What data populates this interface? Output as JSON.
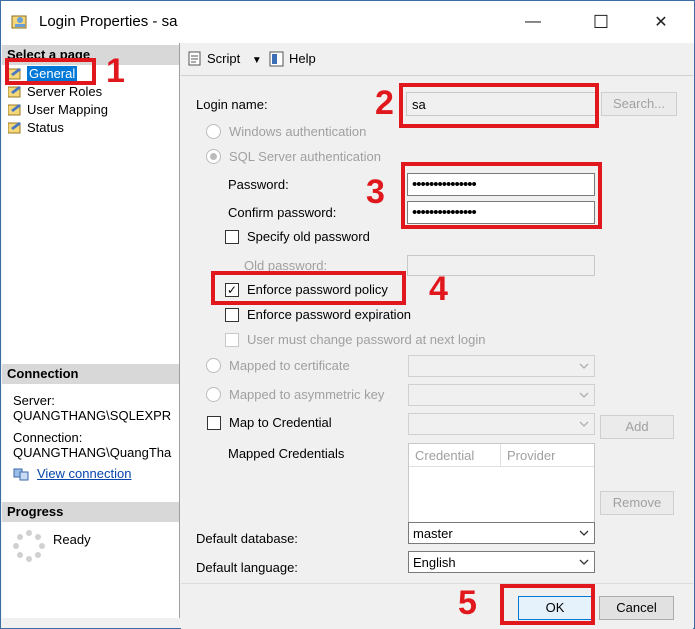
{
  "window": {
    "title": "Login Properties - sa",
    "minimize": "—",
    "maximize": "☐",
    "close": "✕"
  },
  "left": {
    "select_page_header": "Select a page",
    "pages": [
      "General",
      "Server Roles",
      "User Mapping",
      "Status"
    ],
    "connection_header": "Connection",
    "server_label": "Server:",
    "server_value": "QUANGTHANG\\SQLEXPR",
    "connection_label": "Connection:",
    "connection_value": "QUANGTHANG\\QuangTha",
    "view_connection": "View connection",
    "progress_header": "Progress",
    "progress_status": "Ready"
  },
  "toolbar": {
    "script": "Script",
    "help": "Help"
  },
  "form": {
    "login_name_label": "Login name:",
    "login_name_value": "sa",
    "search_button": "Search...",
    "windows_auth": "Windows authentication",
    "sql_auth": "SQL Server authentication",
    "password_label": "Password:",
    "password_value": "•••••••••••••••",
    "confirm_label": "Confirm password:",
    "confirm_value": "•••••••••••••••",
    "specify_old": "Specify old password",
    "old_password_label": "Old password:",
    "enforce_policy": "Enforce password policy",
    "enforce_expiration": "Enforce password expiration",
    "must_change": "User must change password at next login",
    "mapped_cert": "Mapped to certificate",
    "mapped_asym": "Mapped to asymmetric key",
    "map_credential": "Map to Credential",
    "add_button": "Add",
    "mapped_credentials": "Mapped Credentials",
    "col_credential": "Credential",
    "col_provider": "Provider",
    "remove_button": "Remove",
    "default_db_label": "Default database:",
    "default_db_value": "master",
    "default_lang_label": "Default language:",
    "default_lang_value": "English"
  },
  "footer": {
    "ok": "OK",
    "cancel": "Cancel"
  },
  "annotations": {
    "n1": "1",
    "n2": "2",
    "n3": "3",
    "n4": "4",
    "n5": "5"
  },
  "colors": {
    "annotation": "#e0181e",
    "selection": "#0078d7",
    "link": "#0645ad"
  }
}
